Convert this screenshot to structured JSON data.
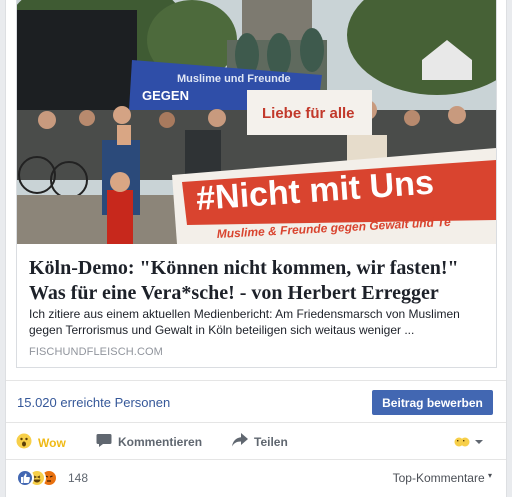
{
  "link_card": {
    "title": "Köln-Demo: \"Können nicht kommen, wir fasten!\" Was für eine Vera*sche! - von Herbert Erregger",
    "description": "Ich zitiere aus einem aktuellen Medienbericht: Am Friedensmarsch von Muslimen gegen Terrorismus und Gewalt in Köln beteiligen sich weitaus weniger ...",
    "domain": "FISCHUNDFLEISCH.COM",
    "image": {
      "banner_main": "#Nicht mit Uns",
      "banner_sub": "Muslime & Freunde gegen Gewalt und Te",
      "flag_text": "GEGEN",
      "flag_top": "Muslime und Freunde",
      "sign_text": "Liebe für alle"
    }
  },
  "reach": {
    "text": "15.020 erreichte Personen",
    "promote_label": "Beitrag bewerben"
  },
  "actions": {
    "wow_label": "Wow",
    "comment_label": "Kommentieren",
    "share_label": "Teilen"
  },
  "reactions": {
    "count": "148",
    "top_comments_label": "Top-Kommentare"
  },
  "colors": {
    "link_blue": "#365899",
    "button_blue": "#4267b2",
    "wow_yellow": "#f0ba15",
    "angry_orange": "#e9710f"
  }
}
